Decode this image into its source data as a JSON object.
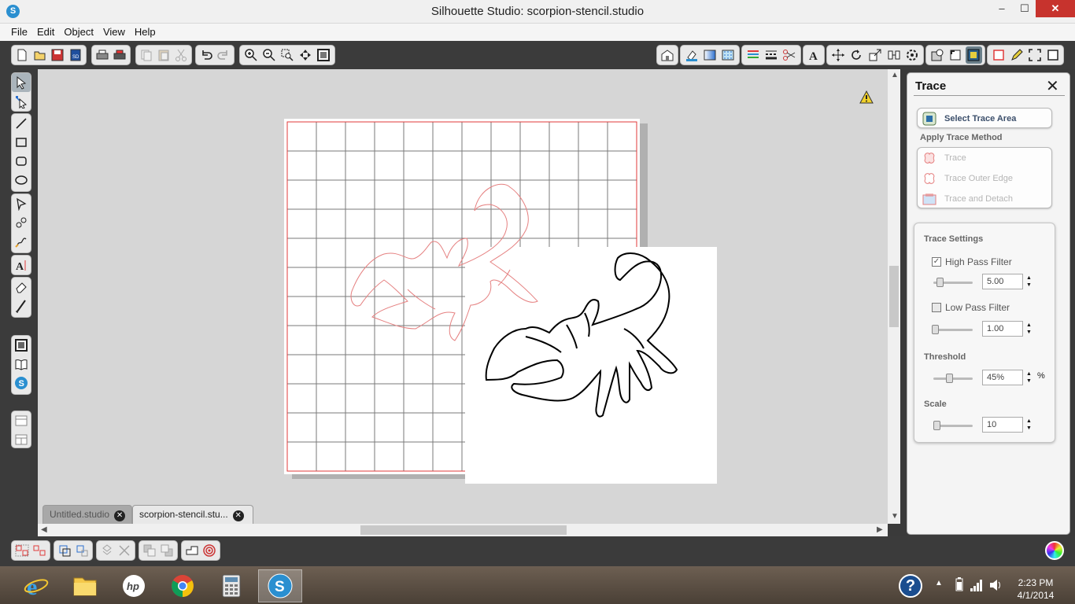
{
  "window": {
    "title": "Silhouette Studio: scorpion-stencil.studio",
    "min_glyph": "–",
    "max_glyph": "☐",
    "close_glyph": "✕"
  },
  "menu": [
    "File",
    "Edit",
    "Object",
    "View",
    "Help"
  ],
  "toolbar": {
    "left_icons": [
      "new-icon",
      "open-icon",
      "save-icon",
      "save-sd-icon",
      "print-icon",
      "print-cut-icon",
      "copy-icon",
      "paste-icon",
      "cut-icon",
      "undo-icon",
      "redo-icon",
      "zoom-in-icon",
      "zoom-out-icon",
      "zoom-select-icon",
      "pan-icon",
      "fit-page-icon"
    ],
    "right_icons": [
      "library-icon",
      "fill-color-icon",
      "fill-gradient-icon",
      "fill-pattern-icon",
      "line-color-icon",
      "line-style-icon",
      "cut-style-icon",
      "text-style-icon",
      "transform-icon",
      "rotate-icon",
      "scale-icon",
      "align-icon",
      "replicate-icon",
      "offset-icon",
      "design-page-icon",
      "registration-icon",
      "trace-icon",
      "sketch-icon",
      "pen-icon",
      "fullscreen-icon"
    ]
  },
  "tabs": [
    {
      "label": "Untitled.studio",
      "active": false
    },
    {
      "label": "scorpion-stencil.stu...",
      "active": true
    }
  ],
  "trace_panel": {
    "title": "Trace",
    "select_trace_area": "Select Trace Area",
    "apply_method_label": "Apply Trace Method",
    "methods": [
      "Trace",
      "Trace Outer Edge",
      "Trace and Detach"
    ],
    "settings_label": "Trace Settings",
    "high_pass_label": "High Pass Filter",
    "high_pass_checked": true,
    "high_pass_value": "5.00",
    "low_pass_label": "Low Pass Filter",
    "low_pass_checked": false,
    "low_pass_value": "1.00",
    "threshold_label": "Threshold",
    "threshold_value": "45%",
    "threshold_unit": "%",
    "scale_label": "Scale",
    "scale_value": "10"
  },
  "colors": {
    "accent_red": "#e03a3a",
    "trace_red": "#e58080",
    "panel_bg": "#f4f4f4"
  },
  "taskbar": {
    "apps": [
      "internet-explorer-icon",
      "file-explorer-icon",
      "hp-icon",
      "chrome-icon",
      "calculator-icon",
      "silhouette-studio-icon"
    ],
    "time": "2:23 PM",
    "date": "4/1/2014"
  },
  "warning_icon": "warning-icon"
}
